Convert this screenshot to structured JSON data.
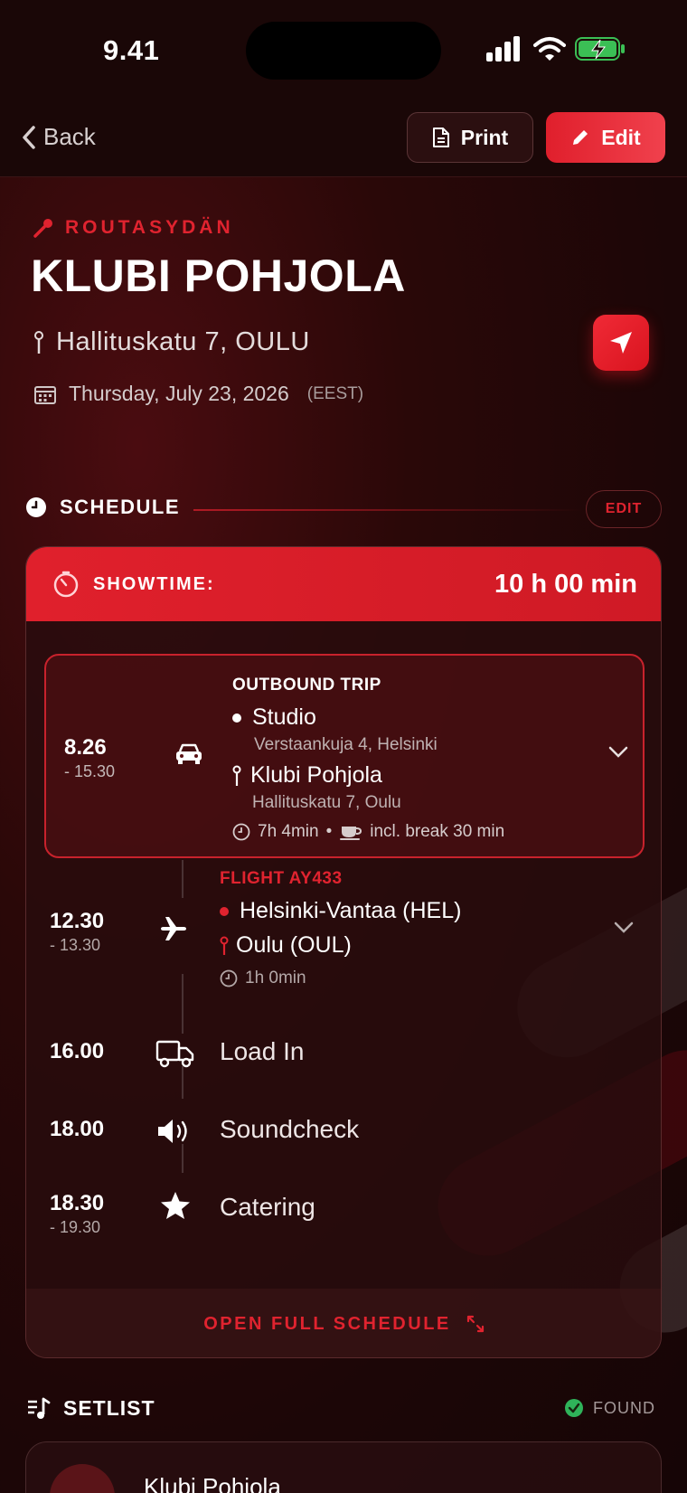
{
  "status_bar": {
    "time": "9.41"
  },
  "nav": {
    "back_label": "Back",
    "print_label": "Print",
    "edit_label": "Edit"
  },
  "event": {
    "artist": "ROUTASYDÄN",
    "venue": "KLUBI POHJOLA",
    "address": "Hallituskatu 7, OULU",
    "date": "Thursday, July 23, 2026",
    "timezone": "(EEST)"
  },
  "schedule": {
    "heading": "SCHEDULE",
    "edit_label": "EDIT",
    "showtime_label": "SHOWTIME:",
    "showtime_value": "10 h 00 min",
    "outbound": {
      "start": "8.26",
      "end": "- 15.30",
      "title": "OUTBOUND TRIP",
      "from_name": "Studio",
      "from_address": "Verstaankuja 4, Helsinki",
      "to_name": "Klubi Pohjola",
      "to_address": "Hallituskatu 7, Oulu",
      "duration": "7h 4min",
      "break_info": "incl. break 30 min"
    },
    "flight": {
      "start": "12.30",
      "end": "- 13.30",
      "title": "FLIGHT AY433",
      "from": "Helsinki-Vantaa (HEL)",
      "to": "Oulu (OUL)",
      "duration": "1h 0min"
    },
    "events": [
      {
        "time": "16.00",
        "end": "",
        "label": "Load In",
        "icon": "truck-icon"
      },
      {
        "time": "18.00",
        "end": "",
        "label": "Soundcheck",
        "icon": "speaker-icon"
      },
      {
        "time": "18.30",
        "end": "- 19.30",
        "label": "Catering",
        "icon": "star-icon"
      }
    ],
    "open_full_label": "OPEN FULL SCHEDULE"
  },
  "setlist": {
    "heading": "SETLIST",
    "status": "FOUND",
    "item_name": "Klubi Pohjola"
  },
  "colors": {
    "accent": "#e0232f",
    "background": "#1c0607",
    "success": "#2fb35a"
  }
}
